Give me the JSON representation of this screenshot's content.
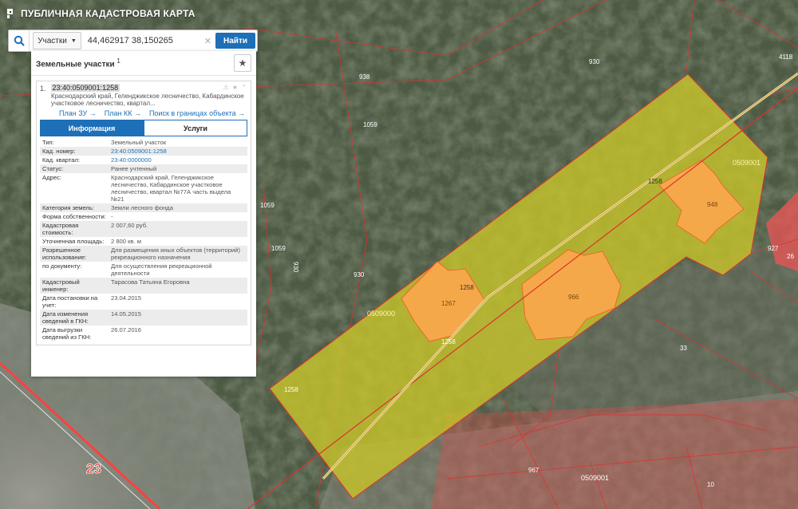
{
  "app": {
    "title": "ПУБЛИЧНАЯ КАДАСТРОВАЯ КАРТА"
  },
  "search": {
    "type_label": "Участки",
    "query": "44,462917 38,150265",
    "button": "Найти"
  },
  "panel": {
    "title": "Земельные участки",
    "count": "1",
    "result": {
      "index": "1.",
      "cadnum": "23:40:0509001:1258",
      "address_short": "Краснодарский край, Геленджикское лесничество, Кабардинское участковое лесничество, квартал...",
      "links": [
        "План ЗУ →",
        "План КК →",
        "Поиск в границах объекта →"
      ],
      "tabs": [
        "Информация",
        "Услуги"
      ],
      "rows": [
        {
          "k": "Тип:",
          "v": "Земельный участок"
        },
        {
          "k": "Кад. номер:",
          "v": "23:40:0509001:1258"
        },
        {
          "k": "Кад. квартал:",
          "v": "23:40:0000000"
        },
        {
          "k": "Статус:",
          "v": "Ранее учтенный"
        },
        {
          "k": "Адрес:",
          "v": "Краснодарский край, Геленджикское лесничество, Кабардинское участковое лесничество, квартал №77А часть выдела №21"
        },
        {
          "k": "Категория земель:",
          "v": "Земли лесного фонда"
        },
        {
          "k": "Форма собственности:",
          "v": "-"
        },
        {
          "k": "Кадастровая стоимость:",
          "v": "2 007,60 руб."
        },
        {
          "k": "Уточненная площадь:",
          "v": "2 800 кв. м"
        },
        {
          "k": "Разрешенное использование:",
          "v": "Для размещения иных объектов (территорий) рекреационного назначения"
        },
        {
          "k": "по документу:",
          "v": "Для осуществления рекреационной деятельности"
        },
        {
          "k": "Кадастровый инженер:",
          "v": "Тарасова Татьяна Егоровна"
        },
        {
          "k": "Дата постановки на учет:",
          "v": "23.04.2015"
        },
        {
          "k": "Дата изменения сведений в ГКН:",
          "v": "14.05.2015"
        },
        {
          "k": "Дата выгрузки сведений из ГКН:",
          "v": "26.07.2016"
        }
      ]
    }
  },
  "map_labels": {
    "parcels": [
      "938",
      "1059",
      "1059",
      "1059",
      "930",
      "930",
      "930",
      "4118",
      "1258",
      "1258",
      "1258",
      "1258",
      "927",
      "26",
      "33",
      "967",
      "10",
      "1267",
      "966",
      "948"
    ],
    "quarters": [
      "0509001",
      "0509000",
      "0509001"
    ],
    "road": "23"
  },
  "colors": {
    "parcel_fill": "#c8c42a",
    "building_fill": "#f5a84a",
    "boundary": "#e03030",
    "accent": "#1d6fb8"
  }
}
